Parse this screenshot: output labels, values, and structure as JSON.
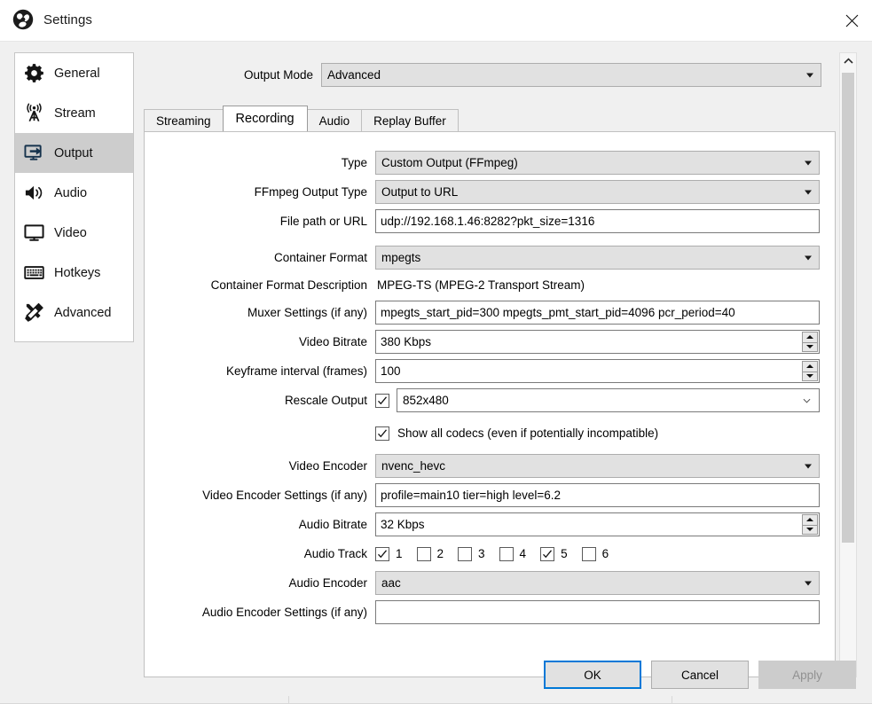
{
  "window": {
    "title": "Settings",
    "logo_icon": "obs-logo-icon",
    "close_icon": "close-icon"
  },
  "sidebar": {
    "items": [
      {
        "label": "General",
        "icon": "gear-icon",
        "selected": false
      },
      {
        "label": "Stream",
        "icon": "broadcast-icon",
        "selected": false
      },
      {
        "label": "Output",
        "icon": "output-icon",
        "selected": true
      },
      {
        "label": "Audio",
        "icon": "speaker-icon",
        "selected": false
      },
      {
        "label": "Video",
        "icon": "monitor-icon",
        "selected": false
      },
      {
        "label": "Hotkeys",
        "icon": "keyboard-icon",
        "selected": false
      },
      {
        "label": "Advanced",
        "icon": "tools-icon",
        "selected": false
      }
    ]
  },
  "output_mode": {
    "label": "Output Mode",
    "value": "Advanced"
  },
  "tabs": [
    {
      "label": "Streaming",
      "active": false
    },
    {
      "label": "Recording",
      "active": true
    },
    {
      "label": "Audio",
      "active": false
    },
    {
      "label": "Replay Buffer",
      "active": false
    }
  ],
  "recording": {
    "type": {
      "label": "Type",
      "value": "Custom Output (FFmpeg)"
    },
    "ffmpeg_output_type": {
      "label": "FFmpeg Output Type",
      "value": "Output to URL"
    },
    "file_path": {
      "label": "File path or URL",
      "value": "udp://192.168.1.46:8282?pkt_size=1316"
    },
    "container_format": {
      "label": "Container Format",
      "value": "mpegts"
    },
    "container_description": {
      "label": "Container Format Description",
      "value": "MPEG-TS (MPEG-2 Transport Stream)"
    },
    "muxer_settings": {
      "label": "Muxer Settings (if any)",
      "value": "mpegts_start_pid=300 mpegts_pmt_start_pid=4096 pcr_period=40"
    },
    "video_bitrate": {
      "label": "Video Bitrate",
      "value": "380 Kbps"
    },
    "keyframe_interval": {
      "label": "Keyframe interval (frames)",
      "value": "100"
    },
    "rescale_output": {
      "label": "Rescale Output",
      "checked": true,
      "value": "852x480"
    },
    "show_all_codecs": {
      "label": "Show all codecs (even if potentially incompatible)",
      "checked": true
    },
    "video_encoder": {
      "label": "Video Encoder",
      "value": "nvenc_hevc"
    },
    "video_encoder_settings": {
      "label": "Video Encoder Settings (if any)",
      "value": "profile=main10 tier=high level=6.2"
    },
    "audio_bitrate": {
      "label": "Audio Bitrate",
      "value": "32 Kbps"
    },
    "audio_track": {
      "label": "Audio Track",
      "tracks": [
        {
          "number": "1",
          "checked": true
        },
        {
          "number": "2",
          "checked": false
        },
        {
          "number": "3",
          "checked": false
        },
        {
          "number": "4",
          "checked": false
        },
        {
          "number": "5",
          "checked": true
        },
        {
          "number": "6",
          "checked": false
        }
      ]
    },
    "audio_encoder": {
      "label": "Audio Encoder",
      "value": "aac"
    },
    "audio_encoder_settings": {
      "label": "Audio Encoder Settings (if any)",
      "value": ""
    }
  },
  "scrollbar": {
    "up_icon": "chevron-up-icon",
    "down_icon": "chevron-down-icon"
  },
  "footer": {
    "ok": "OK",
    "cancel": "Cancel",
    "apply": "Apply"
  },
  "colors": {
    "accent": "#0078d7",
    "dialog_bg": "#f0f0f0",
    "panel_bg": "#ffffff",
    "control_bg": "#e1e1e1",
    "selection_bg": "#cdcdcd",
    "disabled_text": "#919191"
  }
}
